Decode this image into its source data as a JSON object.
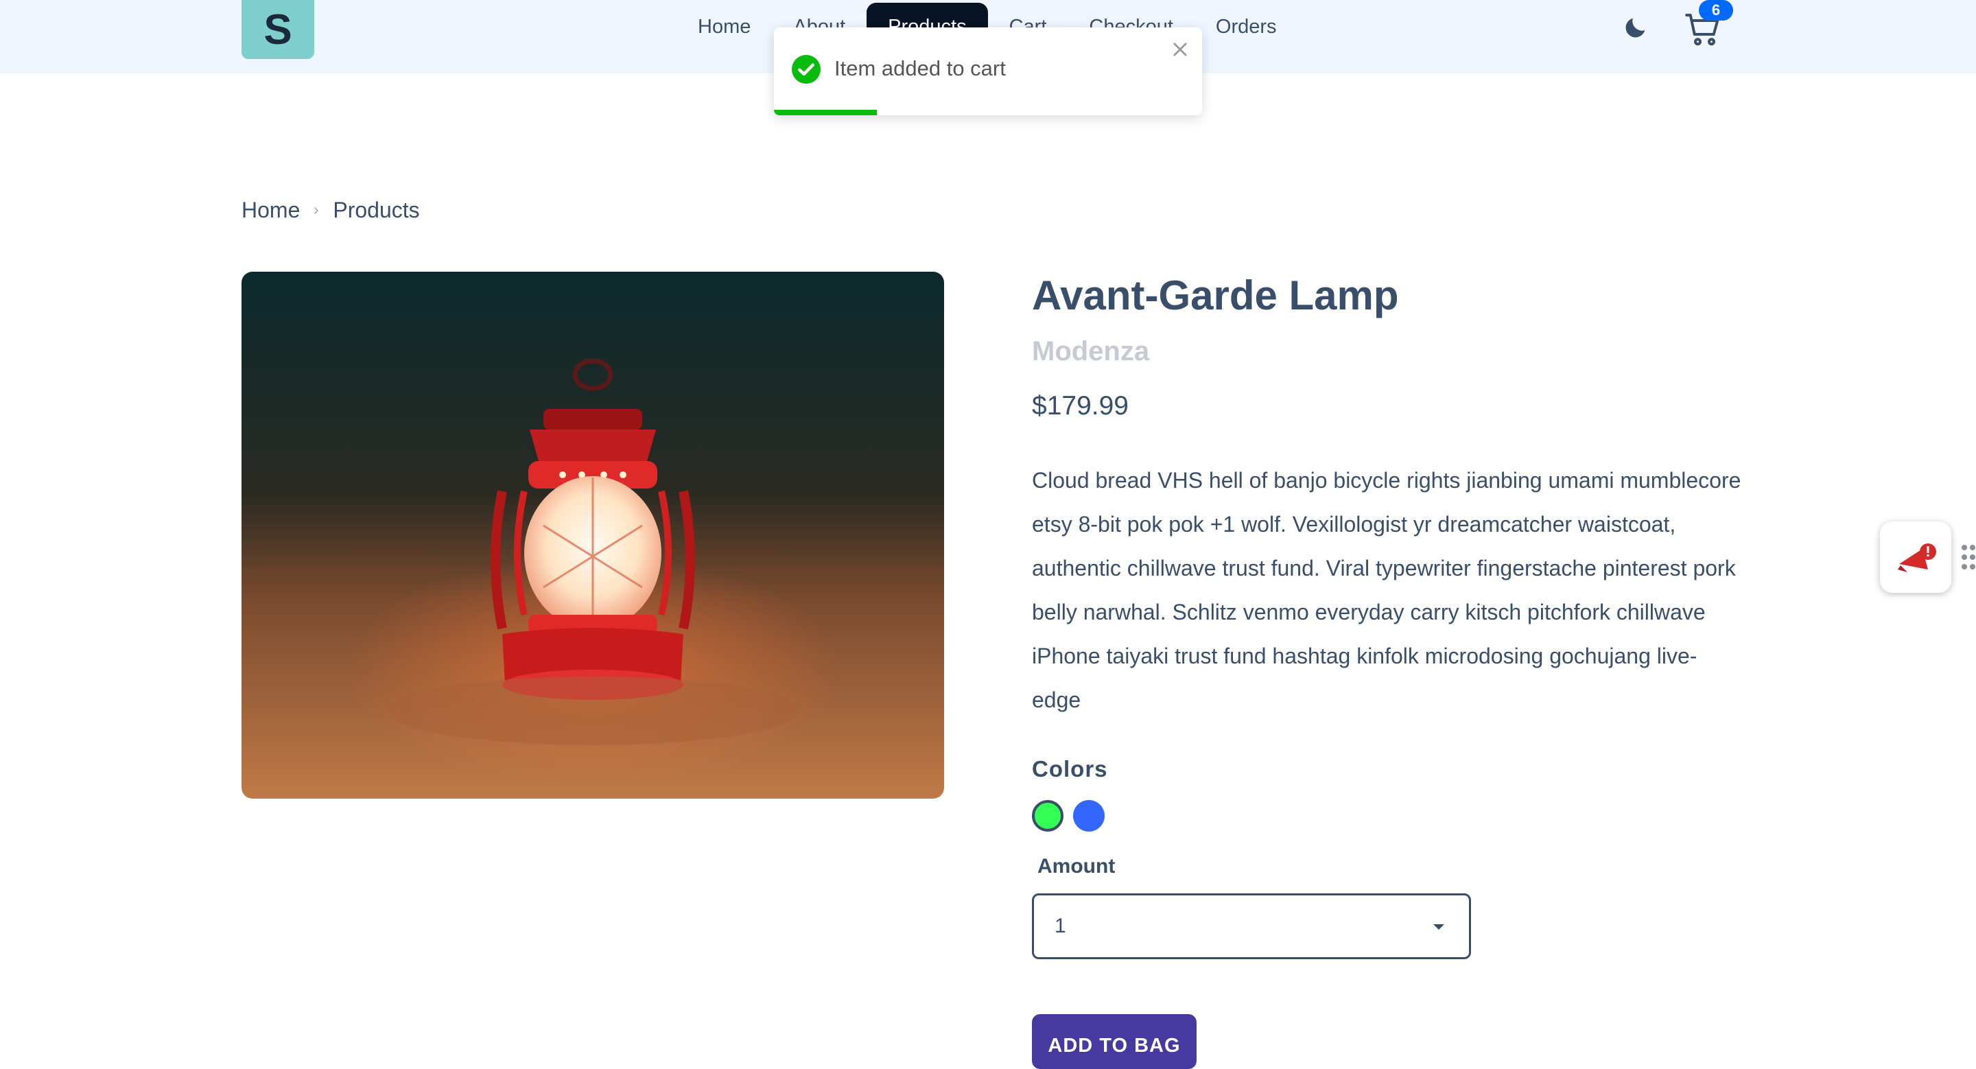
{
  "navbar": {
    "logo_letter": "S",
    "links": [
      {
        "label": "Home",
        "active": false
      },
      {
        "label": "About",
        "active": false
      },
      {
        "label": "Products",
        "active": true
      },
      {
        "label": "Cart",
        "active": false
      },
      {
        "label": "Checkout",
        "active": false
      },
      {
        "label": "Orders",
        "active": false
      }
    ],
    "cart_count": "6",
    "theme_icon": "moon-icon",
    "cart_icon": "cart-icon"
  },
  "toast": {
    "message": "Item added to cart",
    "icon": "check-circle-icon",
    "close_icon": "close-icon",
    "color": "#07bc0c",
    "progress": 0.24
  },
  "breadcrumb": {
    "items": [
      "Home",
      "Products"
    ]
  },
  "product": {
    "title": "Avant-Garde Lamp",
    "company": "Modenza",
    "price": "$179.99",
    "description": "Cloud bread VHS hell of banjo bicycle rights jianbing umami mumblecore etsy 8-bit pok pok +1 wolf. Vexillologist yr dreamcatcher waistcoat, authentic chillwave trust fund. Viral typewriter fingerstache pinterest pork belly narwhal. Schlitz venmo everyday carry kitsch pitchfork chillwave iPhone taiyaki trust fund hashtag kinfolk microdosing gochujang live-edge",
    "colors_label": "Colors",
    "colors": [
      {
        "hex": "#33ff57",
        "selected": true
      },
      {
        "hex": "#3366ff",
        "selected": false
      }
    ],
    "amount_label": "Amount",
    "amount_value": "1",
    "add_button_label": "ADD TO BAG"
  },
  "colors": {
    "primary": "#463aa1",
    "text": "#394e6a",
    "navbar_bg": "#f0f6ff",
    "active_nav": "#061426",
    "badge": "#0069ff"
  }
}
